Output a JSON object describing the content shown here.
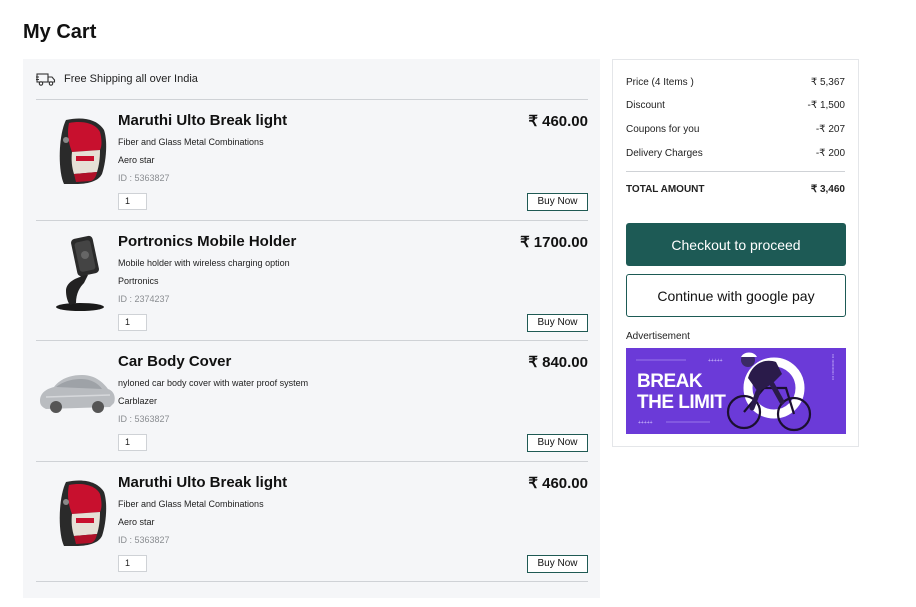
{
  "page": {
    "title": "My Cart"
  },
  "cart": {
    "shipping_notice": "Free Shipping all over India",
    "items": [
      {
        "name": "Maruthi Ulto Break light",
        "price": "₹ 460.00",
        "description": "Fiber and Glass Metal Combinations",
        "brand": "Aero star",
        "id": "ID : 5363827",
        "quantity": "1",
        "buy_label": "Buy Now",
        "image": "tail-light-icon"
      },
      {
        "name": "Portronics Mobile Holder",
        "price": "₹ 1700.00",
        "description": "Mobile holder with wireless charging option",
        "brand": "Portronics",
        "id": "ID : 2374237",
        "quantity": "1",
        "buy_label": "Buy Now",
        "image": "phone-holder-icon"
      },
      {
        "name": "Car Body Cover",
        "price": "₹ 840.00",
        "description": "nyloned car body cover with water proof system",
        "brand": "Carblazer",
        "id": "ID : 5363827",
        "quantity": "1",
        "buy_label": "Buy Now",
        "image": "car-cover-icon"
      },
      {
        "name": "Maruthi Ulto Break light",
        "price": "₹ 460.00",
        "description": "Fiber and Glass Metal Combinations",
        "brand": "Aero star",
        "id": "ID : 5363827",
        "quantity": "1",
        "buy_label": "Buy Now",
        "image": "tail-light-icon"
      }
    ]
  },
  "summary": {
    "rows": [
      {
        "label": "Price (4 Items )",
        "value": "₹ 5,367"
      },
      {
        "label": "Discount",
        "value": "-₹ 1,500"
      },
      {
        "label": "Coupons for you",
        "value": "-₹ 207"
      },
      {
        "label": "Delivery Charges",
        "value": "-₹ 200"
      }
    ],
    "total": {
      "label": "TOTAL AMOUNT",
      "value": "₹ 3,460"
    },
    "checkout_label": "Checkout to proceed",
    "gpay_label": "Continue with google pay",
    "ad_label": "Advertisement",
    "ad_text_line1": "BREAK",
    "ad_text_line2": "THE LIMIT"
  },
  "colors": {
    "primary": "#1d5a55",
    "ad_purple": "#6b3ad8",
    "panel_bg": "#f5f6f8"
  }
}
